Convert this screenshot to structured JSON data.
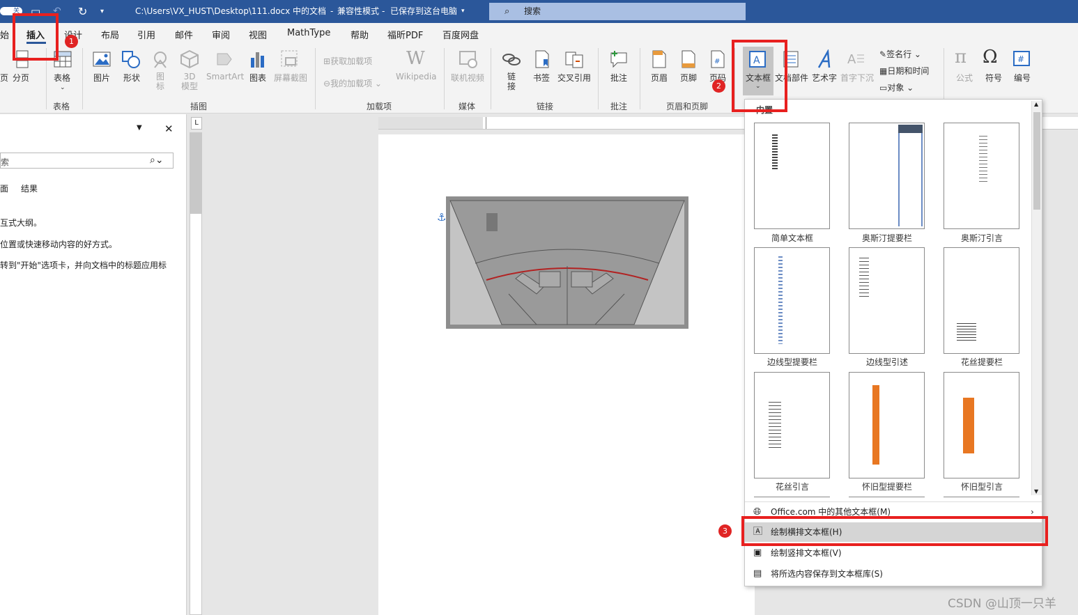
{
  "titlebar": {
    "autosave": "关",
    "path": "C:\\Users\\VX_HUST\\Desktop\\111.docx 中的文档",
    "mode": "兼容性模式",
    "saved": "已保存到这台电脑",
    "search": "搜索"
  },
  "tabs": [
    "始",
    "插入",
    "设计",
    "布局",
    "引用",
    "邮件",
    "审阅",
    "视图",
    "MathType",
    "帮助",
    "福昕PDF",
    "百度网盘"
  ],
  "ribbon": {
    "page_partial": "页",
    "break": "分页",
    "table": "表格",
    "table_group": "表格",
    "picture": "图片",
    "shape": "形状",
    "icons": "图标",
    "icons_l1": "图",
    "icons_l2": "标",
    "model3d_l1": "3D",
    "model3d_l2": "模型",
    "smartart": "SmartArt",
    "chart": "图表",
    "screenshot": "屏幕截图",
    "illustrations_group": "插图",
    "get_addins": "获取加载项",
    "my_addins": "我的加载项",
    "wikipedia": "Wikipedia",
    "addins_group": "加载项",
    "online_video": "联机视频",
    "media_group": "媒体",
    "link_l1": "链",
    "link_l2": "接",
    "bookmark": "书签",
    "crossref": "交叉引用",
    "links_group": "链接",
    "comment": "批注",
    "comment_group": "批注",
    "header": "页眉",
    "footer": "页脚",
    "page_number": "页码",
    "hf_group": "页眉和页脚",
    "textbox": "文本框",
    "quickparts": "文档部件",
    "wordart": "艺术字",
    "dropcap": "首字下沉",
    "signature": "签名行",
    "datetime": "日期和时间",
    "object": "对象",
    "equation": "公式",
    "symbol": "符号",
    "number": "编号"
  },
  "navpane": {
    "search_placeholder": "索",
    "tab_pages": "面",
    "tab_results": "结果",
    "line1": "互式大纲。",
    "line2": "位置或快速移动内容的好方式。",
    "line3": "转到\"开始\"选项卡，并向文档中的标题应用标"
  },
  "dropdown": {
    "section": "内置",
    "items": [
      {
        "label": "简单文本框"
      },
      {
        "label": "奥斯汀提要栏"
      },
      {
        "label": "奥斯汀引言"
      },
      {
        "label": "边线型提要栏"
      },
      {
        "label": "边线型引述"
      },
      {
        "label": "花丝提要栏"
      },
      {
        "label": "花丝引言"
      },
      {
        "label": "怀旧型提要栏"
      },
      {
        "label": "怀旧型引言"
      }
    ],
    "menu": {
      "more": "Office.com 中的其他文本框(M)",
      "draw_h": "绘制横排文本框(H)",
      "draw_v": "绘制竖排文本框(V)",
      "save": "将所选内容保存到文本框库(S)"
    }
  },
  "badges": [
    "1",
    "2",
    "3"
  ],
  "watermark": "CSDN @山顶一只羊",
  "colors": {
    "title_bar": "#2b579a",
    "highlight": "#e8201f",
    "accent_orange": "#e87722"
  }
}
